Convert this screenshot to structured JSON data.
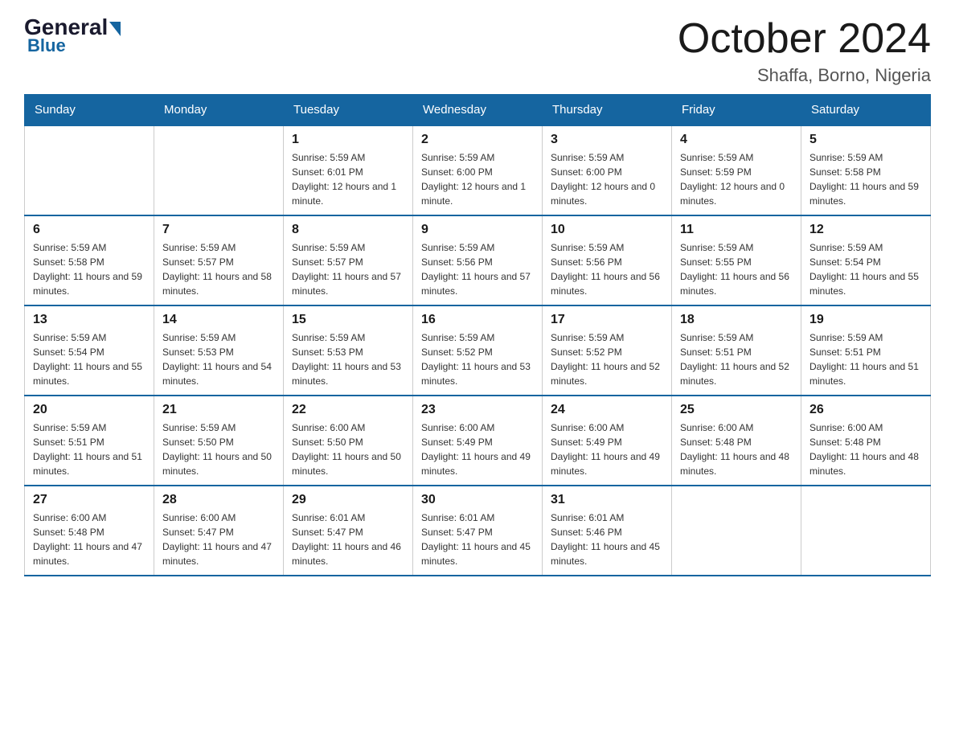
{
  "logo": {
    "general": "General",
    "blue": "Blue"
  },
  "header": {
    "month": "October 2024",
    "location": "Shaffa, Borno, Nigeria"
  },
  "weekdays": [
    "Sunday",
    "Monday",
    "Tuesday",
    "Wednesday",
    "Thursday",
    "Friday",
    "Saturday"
  ],
  "weeks": [
    [
      {
        "day": "",
        "info": ""
      },
      {
        "day": "",
        "info": ""
      },
      {
        "day": "1",
        "info": "Sunrise: 5:59 AM\nSunset: 6:01 PM\nDaylight: 12 hours and 1 minute."
      },
      {
        "day": "2",
        "info": "Sunrise: 5:59 AM\nSunset: 6:00 PM\nDaylight: 12 hours and 1 minute."
      },
      {
        "day": "3",
        "info": "Sunrise: 5:59 AM\nSunset: 6:00 PM\nDaylight: 12 hours and 0 minutes."
      },
      {
        "day": "4",
        "info": "Sunrise: 5:59 AM\nSunset: 5:59 PM\nDaylight: 12 hours and 0 minutes."
      },
      {
        "day": "5",
        "info": "Sunrise: 5:59 AM\nSunset: 5:58 PM\nDaylight: 11 hours and 59 minutes."
      }
    ],
    [
      {
        "day": "6",
        "info": "Sunrise: 5:59 AM\nSunset: 5:58 PM\nDaylight: 11 hours and 59 minutes."
      },
      {
        "day": "7",
        "info": "Sunrise: 5:59 AM\nSunset: 5:57 PM\nDaylight: 11 hours and 58 minutes."
      },
      {
        "day": "8",
        "info": "Sunrise: 5:59 AM\nSunset: 5:57 PM\nDaylight: 11 hours and 57 minutes."
      },
      {
        "day": "9",
        "info": "Sunrise: 5:59 AM\nSunset: 5:56 PM\nDaylight: 11 hours and 57 minutes."
      },
      {
        "day": "10",
        "info": "Sunrise: 5:59 AM\nSunset: 5:56 PM\nDaylight: 11 hours and 56 minutes."
      },
      {
        "day": "11",
        "info": "Sunrise: 5:59 AM\nSunset: 5:55 PM\nDaylight: 11 hours and 56 minutes."
      },
      {
        "day": "12",
        "info": "Sunrise: 5:59 AM\nSunset: 5:54 PM\nDaylight: 11 hours and 55 minutes."
      }
    ],
    [
      {
        "day": "13",
        "info": "Sunrise: 5:59 AM\nSunset: 5:54 PM\nDaylight: 11 hours and 55 minutes."
      },
      {
        "day": "14",
        "info": "Sunrise: 5:59 AM\nSunset: 5:53 PM\nDaylight: 11 hours and 54 minutes."
      },
      {
        "day": "15",
        "info": "Sunrise: 5:59 AM\nSunset: 5:53 PM\nDaylight: 11 hours and 53 minutes."
      },
      {
        "day": "16",
        "info": "Sunrise: 5:59 AM\nSunset: 5:52 PM\nDaylight: 11 hours and 53 minutes."
      },
      {
        "day": "17",
        "info": "Sunrise: 5:59 AM\nSunset: 5:52 PM\nDaylight: 11 hours and 52 minutes."
      },
      {
        "day": "18",
        "info": "Sunrise: 5:59 AM\nSunset: 5:51 PM\nDaylight: 11 hours and 52 minutes."
      },
      {
        "day": "19",
        "info": "Sunrise: 5:59 AM\nSunset: 5:51 PM\nDaylight: 11 hours and 51 minutes."
      }
    ],
    [
      {
        "day": "20",
        "info": "Sunrise: 5:59 AM\nSunset: 5:51 PM\nDaylight: 11 hours and 51 minutes."
      },
      {
        "day": "21",
        "info": "Sunrise: 5:59 AM\nSunset: 5:50 PM\nDaylight: 11 hours and 50 minutes."
      },
      {
        "day": "22",
        "info": "Sunrise: 6:00 AM\nSunset: 5:50 PM\nDaylight: 11 hours and 50 minutes."
      },
      {
        "day": "23",
        "info": "Sunrise: 6:00 AM\nSunset: 5:49 PM\nDaylight: 11 hours and 49 minutes."
      },
      {
        "day": "24",
        "info": "Sunrise: 6:00 AM\nSunset: 5:49 PM\nDaylight: 11 hours and 49 minutes."
      },
      {
        "day": "25",
        "info": "Sunrise: 6:00 AM\nSunset: 5:48 PM\nDaylight: 11 hours and 48 minutes."
      },
      {
        "day": "26",
        "info": "Sunrise: 6:00 AM\nSunset: 5:48 PM\nDaylight: 11 hours and 48 minutes."
      }
    ],
    [
      {
        "day": "27",
        "info": "Sunrise: 6:00 AM\nSunset: 5:48 PM\nDaylight: 11 hours and 47 minutes."
      },
      {
        "day": "28",
        "info": "Sunrise: 6:00 AM\nSunset: 5:47 PM\nDaylight: 11 hours and 47 minutes."
      },
      {
        "day": "29",
        "info": "Sunrise: 6:01 AM\nSunset: 5:47 PM\nDaylight: 11 hours and 46 minutes."
      },
      {
        "day": "30",
        "info": "Sunrise: 6:01 AM\nSunset: 5:47 PM\nDaylight: 11 hours and 45 minutes."
      },
      {
        "day": "31",
        "info": "Sunrise: 6:01 AM\nSunset: 5:46 PM\nDaylight: 11 hours and 45 minutes."
      },
      {
        "day": "",
        "info": ""
      },
      {
        "day": "",
        "info": ""
      }
    ]
  ]
}
